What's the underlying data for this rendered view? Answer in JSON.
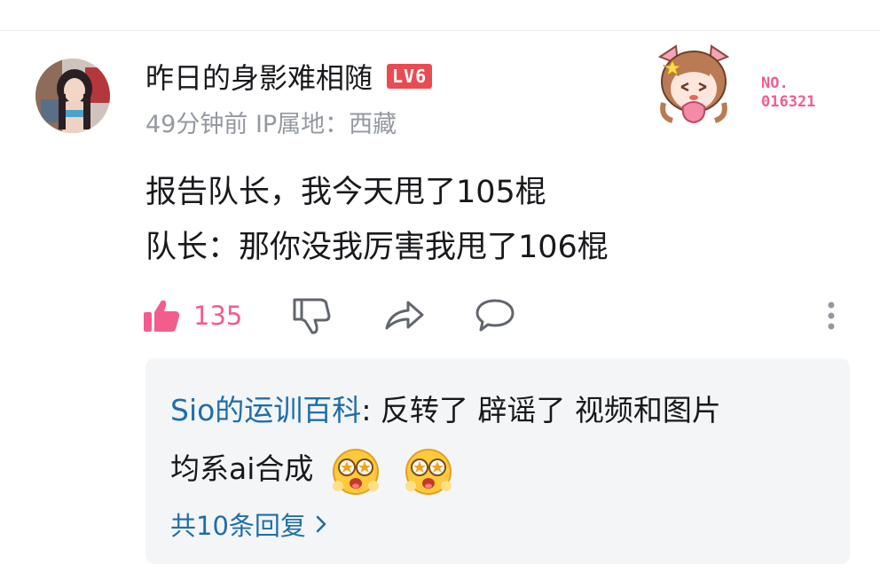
{
  "comment": {
    "username": "昨日的身影难相随",
    "level": "LV6",
    "meta": "49分钟前 IP属地：西藏",
    "fan_badge": {
      "line1": "NO.",
      "line2": "016321"
    },
    "content_lines": [
      "报告队长，我今天甩了105棍",
      "队长：那你没我厉害我甩了106棍"
    ],
    "like_count": "135",
    "colors": {
      "accent_pink": "#f25d8e",
      "link_blue": "#1f6ea8",
      "level_red": "#ea4b52",
      "meta_gray": "#9499a0"
    }
  },
  "reply_preview": {
    "author": "Sio的运训百科",
    "separator": ": ",
    "text_line1": "反转了 辟谣了 视频和图片",
    "text_line2": "均系ai合成",
    "emoji_name": "astonished-emoji",
    "more_label": "共10条回复"
  },
  "icons": [
    "thumbs-up-icon",
    "thumbs-down-icon",
    "share-icon",
    "comment-icon",
    "more-vertical-icon",
    "chevron-right-icon"
  ]
}
